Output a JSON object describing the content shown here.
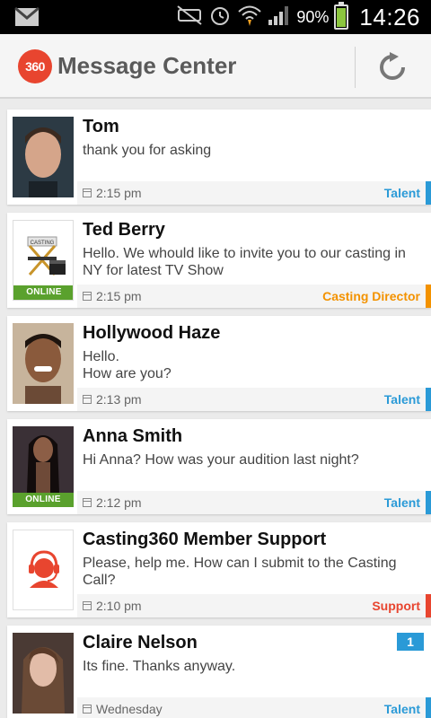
{
  "status_bar": {
    "battery": "90%",
    "time": "14:26"
  },
  "header": {
    "logo_text": "360",
    "title": "Message Center"
  },
  "colors": {
    "talent": "#2a9ad7",
    "casting_director": "#f39200",
    "support": "#e8452f",
    "online": "#5aa12d"
  },
  "messages": [
    {
      "name": "Tom",
      "text": "thank you for asking",
      "time": "2:15 pm",
      "role": "Talent",
      "online": ""
    },
    {
      "name": "Ted Berry",
      "text": "Hello. We whould like to invite you to our casting in NY for latest TV Show",
      "time": "2:15 pm",
      "role": "Casting Director",
      "online": "ONLINE"
    },
    {
      "name": "Hollywood Haze",
      "text": "Hello.\nHow are you?",
      "time": "2:13 pm",
      "role": "Talent",
      "online": ""
    },
    {
      "name": "Anna Smith",
      "text": "Hi Anna? How was your audition last night?",
      "time": "2:12 pm",
      "role": "Talent",
      "online": "ONLINE"
    },
    {
      "name": "Casting360 Member Support",
      "text": "Please, help me. How can I submit to the Casting Call?",
      "time": "2:10 pm",
      "role": "Support",
      "online": ""
    },
    {
      "name": "Claire Nelson",
      "text": "Its fine. Thanks anyway.",
      "time": "Wednesday",
      "role": "Talent",
      "online": "",
      "badge": "1"
    }
  ]
}
